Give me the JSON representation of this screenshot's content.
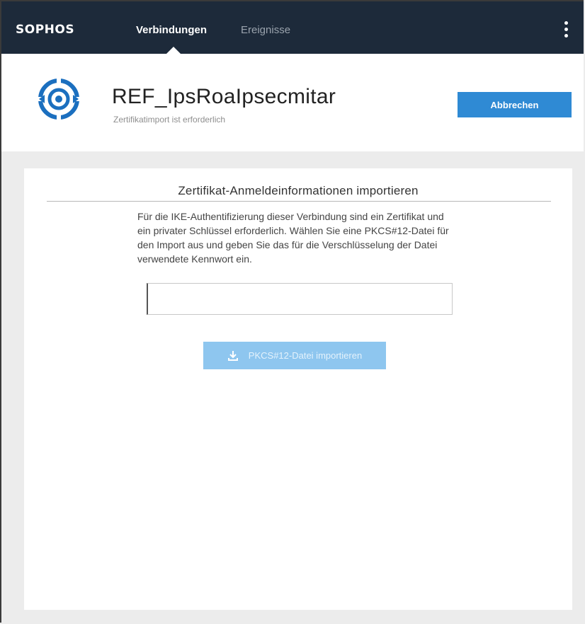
{
  "topbar": {
    "brand": "SOPHOS",
    "tabs": [
      {
        "label": "Verbindungen",
        "active": true
      },
      {
        "label": "Ereignisse",
        "active": false
      }
    ],
    "menu_icon": "kebab-vertical-icon"
  },
  "header": {
    "icon": "target-connection-icon",
    "connection_name": "REF_IpsRoaIpsecmitar",
    "status": "Zertifikatimport ist erforderlich",
    "cancel_label": "Abbrechen"
  },
  "import": {
    "title": "Zertifikat-Anmeldeinformationen importieren",
    "description": "Für die IKE-Authentifizierung dieser Verbindung sind ein Zertifikat und ein privater Schlüssel erforderlich. Wählen Sie eine PKCS#12-Datei für den Import aus und geben Sie das für die Verschlüsselung der Datei verwendete Kennwort ein.",
    "password_value": "",
    "button_label": "PKCS#12-Datei importieren",
    "button_icon": "download-icon"
  },
  "colors": {
    "nav_bg": "#1d2a3a",
    "accent": "#2f8ad4",
    "disabled_accent": "#8ec6ef",
    "background": "#ececec"
  }
}
